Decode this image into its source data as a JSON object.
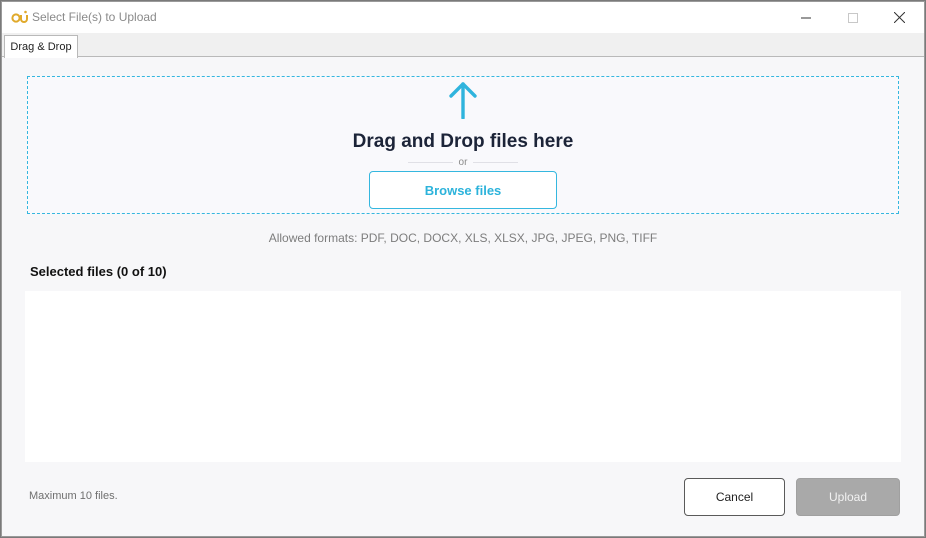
{
  "window": {
    "title": "Select File(s) to Upload",
    "app_icon": "ou-logo-icon",
    "controls": [
      "minimize-icon",
      "maximize-icon",
      "close-icon"
    ]
  },
  "tabs": [
    {
      "label": "Drag & Drop",
      "active": true
    }
  ],
  "dropzone": {
    "icon": "upload-arrow-icon",
    "heading": "Drag and Drop files here",
    "or_text": "or",
    "browse_label": "Browse files"
  },
  "formats_text": "Allowed formats: PDF, DOC, DOCX, XLS, XLSX, JPG, JPEG, PNG, TIFF",
  "selected": {
    "title": "Selected files (0 of 10)",
    "items": []
  },
  "footer": {
    "max_note": "Maximum 10 files.",
    "cancel_label": "Cancel",
    "upload_label": "Upload",
    "upload_enabled": false
  },
  "colors": {
    "accent": "#35b7df",
    "heading": "#1c2438",
    "disabled_button": "#a9a9a9",
    "logo": "#e0a92a"
  }
}
